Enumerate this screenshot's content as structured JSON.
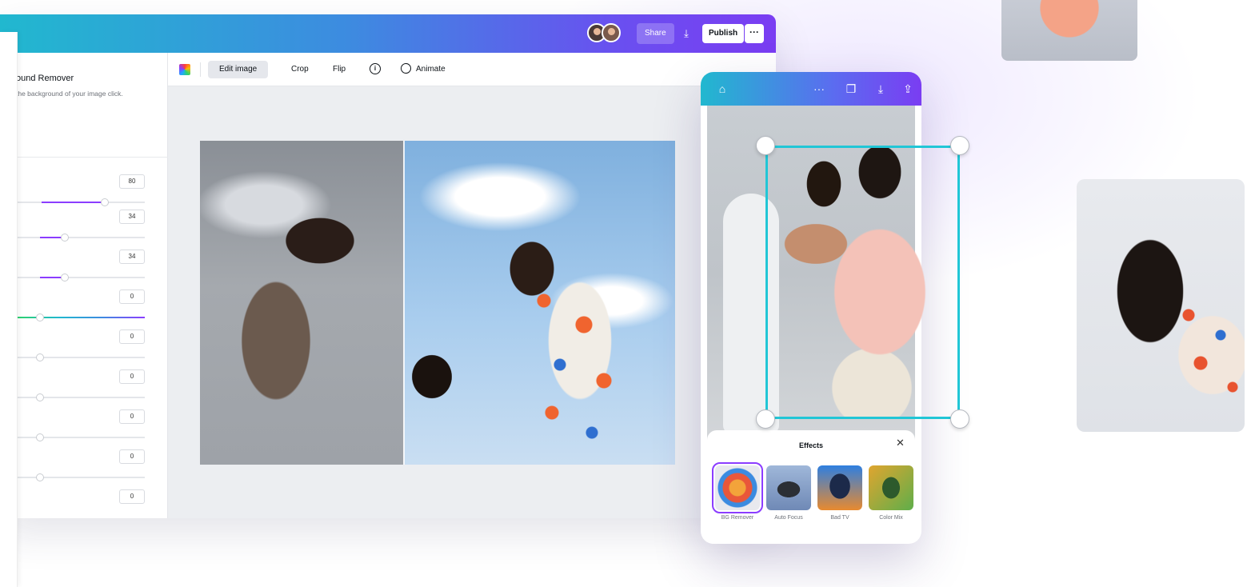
{
  "desktop": {
    "topbar": {
      "share_label": "Share",
      "download_icon": "download-icon",
      "publish_label": "Publish",
      "more_label": "···"
    },
    "panel": {
      "title": "ound Remover",
      "description": "the background of your image click.",
      "slider_values": [
        "80",
        "34",
        "34",
        "0",
        "0",
        "0",
        "0",
        "0",
        "0"
      ]
    },
    "toolbar": {
      "edit_image": "Edit image",
      "crop": "Crop",
      "flip": "Flip",
      "info": "i",
      "animate": "Animate"
    }
  },
  "phone": {
    "icons": {
      "home": "home-icon",
      "more": "more-icon",
      "copy": "copy-icon",
      "download": "download-icon",
      "share": "share-icon"
    },
    "effects": {
      "title": "Effects",
      "close": "✕",
      "items": [
        {
          "label": "BG Remover",
          "selected": true
        },
        {
          "label": "Auto Focus",
          "selected": false
        },
        {
          "label": "Bad TV",
          "selected": false
        },
        {
          "label": "Color Mix",
          "selected": false
        }
      ]
    }
  },
  "colors": {
    "accent_purple": "#8b3dff",
    "selection_teal": "#21c6d6",
    "gradient_start": "#21b8cf",
    "gradient_end": "#7a3df2"
  }
}
